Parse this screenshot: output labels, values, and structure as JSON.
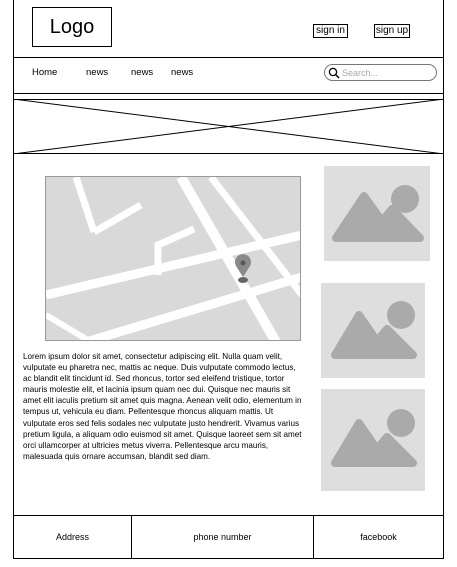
{
  "header": {
    "logo": "Logo",
    "sign_in": "sign in",
    "sign_up": "sign up"
  },
  "nav": {
    "items": [
      "Home",
      "news",
      "news",
      "news"
    ],
    "search_placeholder": "Search..."
  },
  "content": {
    "paragraph": "Lorem ipsum dolor sit amet, consectetur adipiscing elit. Nulla quam velit, vulputate eu pharetra nec, mattis ac neque. Duis vulputate commodo lectus, ac blandit elit tincidunt id. Sed rhoncus, tortor sed eleifend tristique, tortor mauris molestie elit, et lacinia ipsum quam nec dui. Quisque nec mauris sit amet elit iaculis pretium sit amet quis magna. Aenean velit odio, elementum in tempus ut, vehicula eu diam. Pellentesque rhoncus aliquam mattis. Ut vulputate eros sed felis sodales nec vulputate justo hendrerit. Vivamus varius pretium ligula, a aliquam odio euismod sit amet. Quisque laoreet sem sit amet orci ullamcorper at ultricies metus viverra. Pellentesque arcu mauris, malesuada quis ornare accumsan, blandit sed diam."
  },
  "footer": {
    "address": "Address",
    "phone": "phone number",
    "social": "facebook"
  },
  "icons": {
    "map": "map-icon",
    "image": "image-placeholder-icon",
    "search": "search-icon",
    "pin": "location-pin-icon"
  },
  "colors": {
    "placeholder_fill": "#dedede",
    "placeholder_shape": "#aaaaaa",
    "border": "#000000"
  }
}
